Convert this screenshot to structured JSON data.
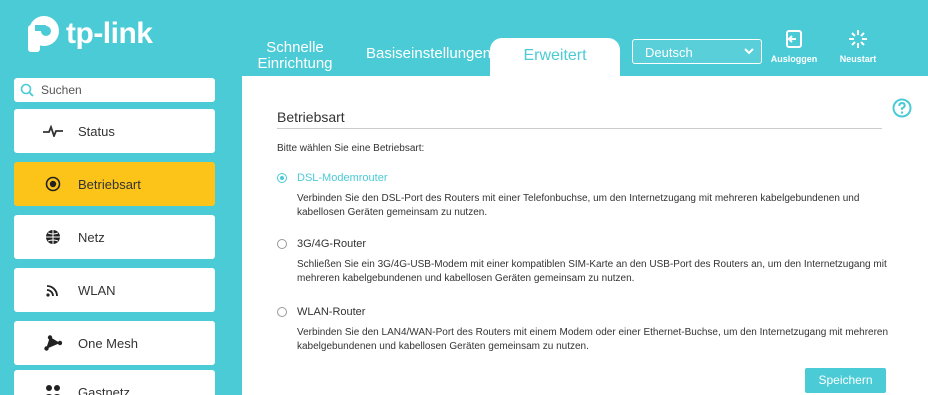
{
  "header": {
    "logo_text": "tp-link",
    "tabs": {
      "quick_setup": "Schnelle Einrichtung",
      "basic": "Basiseinstellungen",
      "advanced": "Erweitert"
    },
    "language": "Deutsch",
    "logout_label": "Ausloggen",
    "reboot_label": "Neustart"
  },
  "sidebar": {
    "search_placeholder": "Suchen",
    "items": [
      {
        "label": "Status",
        "icon": "pulse-icon"
      },
      {
        "label": "Betriebsart",
        "icon": "mode-icon",
        "active": true
      },
      {
        "label": "Netz",
        "icon": "globe-icon"
      },
      {
        "label": "WLAN",
        "icon": "wifi-icon"
      },
      {
        "label": "One Mesh",
        "icon": "mesh-icon"
      },
      {
        "label": "Gastnetz",
        "icon": "guests-icon"
      }
    ]
  },
  "main": {
    "section_title": "Betriebsart",
    "prompt": "Bitte wählen Sie eine Betriebsart:",
    "options": [
      {
        "label": "DSL-Modemrouter",
        "selected": true,
        "description": "Verbinden Sie den DSL-Port des Routers mit einer Telefonbuchse, um den Internetzugang mit mehreren kabelgebundenen und kabellosen Geräten gemeinsam zu nutzen."
      },
      {
        "label": "3G/4G-Router",
        "selected": false,
        "description": "Schließen Sie ein 3G/4G-USB-Modem mit einer kompatiblen SIM-Karte an den USB-Port des Routers an, um den Internetzugang mit mehreren kabelgebundenen und kabellosen Geräten gemeinsam zu nutzen."
      },
      {
        "label": "WLAN-Router",
        "selected": false,
        "description": "Verbinden Sie den LAN4/WAN-Port des Routers mit einem Modem oder einer Ethernet-Buchse, um den Internetzugang mit mehreren kabelgebundenen und kabellosen Geräten gemeinsam zu nutzen."
      }
    ],
    "save_label": "Speichern"
  },
  "colors": {
    "brand": "#4acbd6",
    "active_nav": "#fcc419"
  }
}
